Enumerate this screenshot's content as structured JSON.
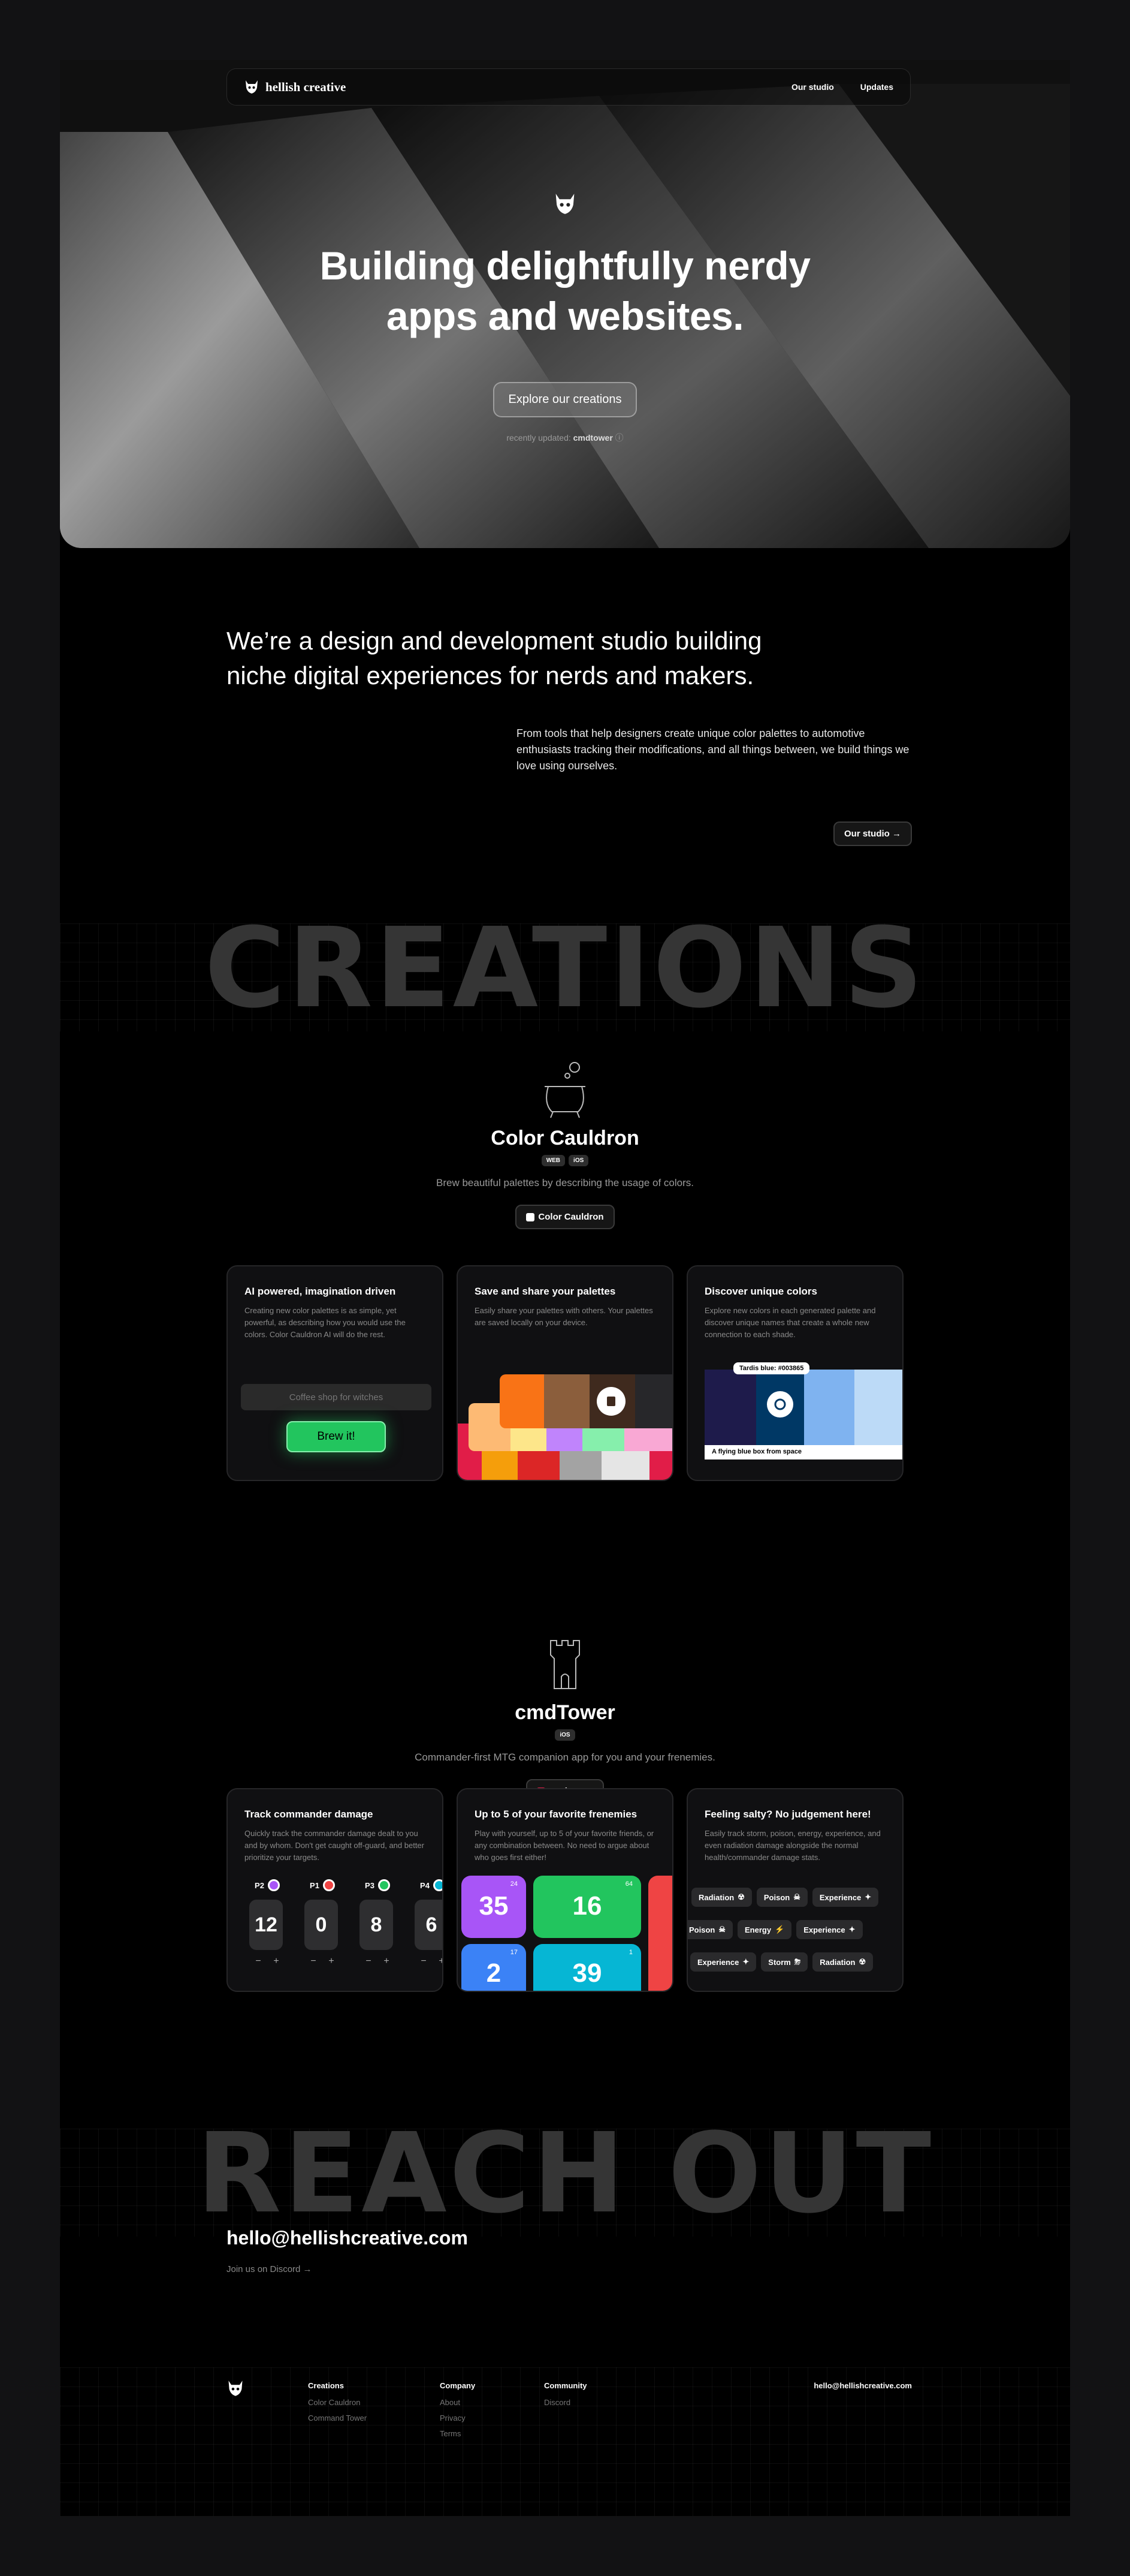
{
  "brand": {
    "name": "hellish creative"
  },
  "nav": {
    "studio": "Our studio",
    "updates": "Updates"
  },
  "hero": {
    "title_line1": "Building delightfully nerdy",
    "title_line2": "apps and websites.",
    "cta": "Explore our creations",
    "updated_prefix": "recently updated:",
    "updated_name": "cmdtower"
  },
  "intro": {
    "heading_line1": "We’re a design and development studio building",
    "heading_line2": "niche digital experiences for nerds and makers.",
    "paragraph": "From tools that help designers create unique color palettes to automotive enthusiasts tracking their modifications, and all things between, we build things we love using ourselves.",
    "button": "Our studio →"
  },
  "sections": {
    "creations": "CREATIONS",
    "reach_out": "REACH OUT"
  },
  "products": [
    {
      "name": "Color Cauldron",
      "tags": [
        "WEB",
        "iOS"
      ],
      "description": "Brew beautiful palettes by describing the usage of colors.",
      "link": "Color Cauldron",
      "cards": [
        {
          "title": "AI powered, imagination driven",
          "text": "Creating new color palettes is as simple, yet powerful, as describing how you would use the colors. Color Cauldron AI will do the rest.",
          "input_placeholder": "Coffee shop for witches",
          "button": "Brew it!"
        },
        {
          "title": "Save and share your palettes",
          "text": "Easily share your palettes with others. Your palettes are saved locally on your device."
        },
        {
          "title": "Discover unique colors",
          "text": "Explore new colors in each generated palette and discover unique names that create a whole new connection to each shade.",
          "tooltip": "Tardis blue: #003865",
          "caption": "A flying blue box from space"
        }
      ]
    },
    {
      "name": "cmdTower",
      "tags": [
        "iOS"
      ],
      "description": "Commander-first MTG companion app for you and your frenemies.",
      "link": "cmdTower",
      "cards": [
        {
          "title": "Track commander damage",
          "text": "Quickly track the commander damage dealt to you and by whom. Don't get caught off-guard, and better prioritize your targets.",
          "players": [
            {
              "label": "P2",
              "value": "12",
              "color": "#a855f7"
            },
            {
              "label": "P1",
              "value": "0",
              "color": "#ef4444"
            },
            {
              "label": "P3",
              "value": "8",
              "color": "#22c55e"
            },
            {
              "label": "P4",
              "value": "6",
              "color": "#06b6d4"
            }
          ]
        },
        {
          "title": "Up to 5 of your favorite frenemies",
          "text": "Play with yourself, up to 5 of your favorite friends, or any combination between. No need to argue about who goes first either!",
          "tiles": [
            {
              "value": "35",
              "color": "#a855f7",
              "mini": "24"
            },
            {
              "value": "16",
              "color": "#22c55e",
              "mini": "64"
            },
            {
              "value": "2",
              "color": "#3b82f6",
              "mini": "17"
            },
            {
              "value": "39",
              "color": "#06b6d4",
              "mini": "1"
            }
          ]
        },
        {
          "title": "Feeling salty? No judgement here!",
          "text": "Easily track storm, poison, energy, experience, and even radiation damage alongside the normal health/commander damage stats.",
          "chips_row1": [
            "Radiation",
            "Poison",
            "Experience"
          ],
          "chips_row2": [
            "Poison",
            "Energy",
            "Experience"
          ],
          "chips_row3": [
            "Experience",
            "Storm",
            "Radiation"
          ]
        }
      ]
    }
  ],
  "contact": {
    "email": "hello@hellishcreative.com",
    "discord": "Join us on Discord →"
  },
  "footer": {
    "creations": {
      "heading": "Creations",
      "links": [
        "Color Cauldron",
        "Command Tower"
      ]
    },
    "company": {
      "heading": "Company",
      "links": [
        "About",
        "Privacy",
        "Terms"
      ]
    },
    "community": {
      "heading": "Community",
      "links": [
        "Discord"
      ]
    },
    "email": "hello@hellishcreative.com"
  }
}
